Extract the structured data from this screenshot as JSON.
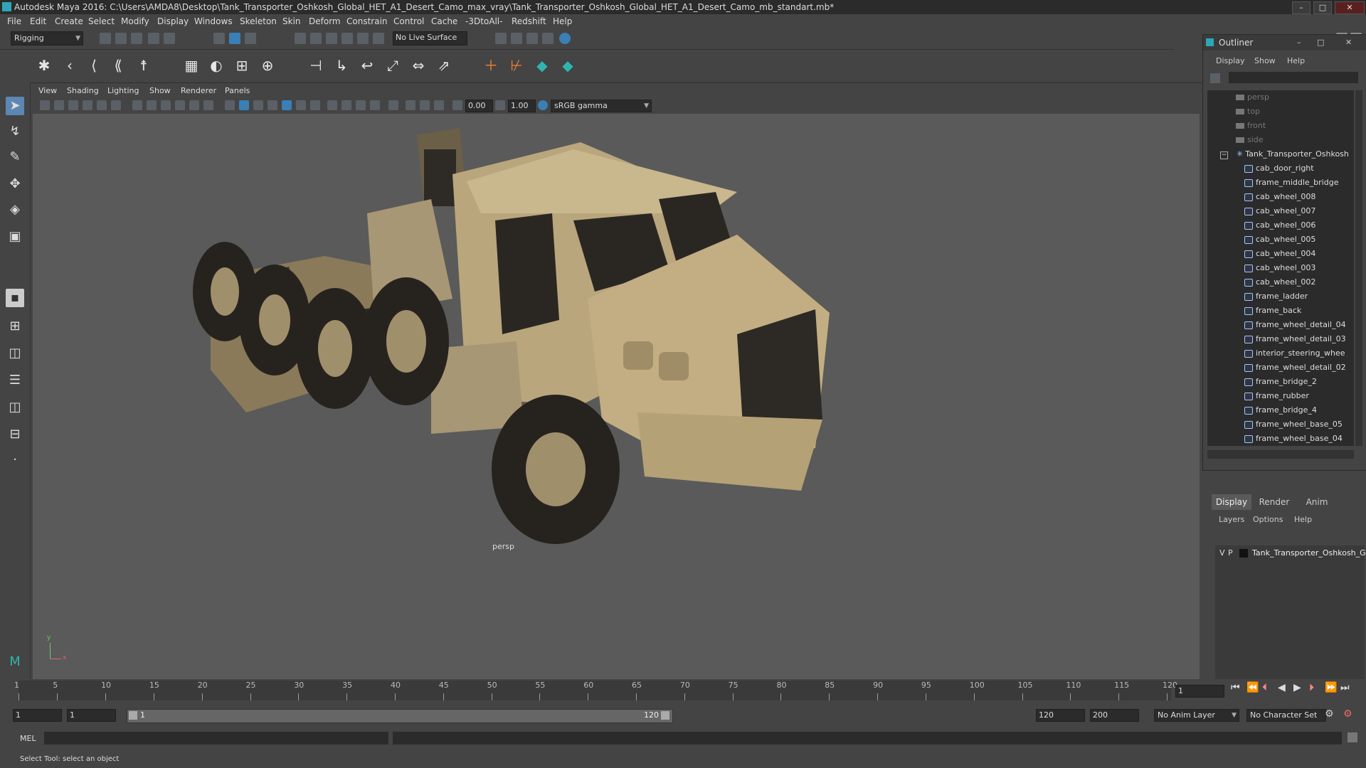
{
  "window": {
    "title": "Autodesk Maya 2016: C:\\Users\\AMDA8\\Desktop\\Tank_Transporter_Oshkosh_Global_HET_A1_Desert_Camo_max_vray\\Tank_Transporter_Oshkosh_Global_HET_A1_Desert_Camo_mb_standart.mb*",
    "min": "–",
    "max": "□",
    "close": "✕"
  },
  "menu": [
    "File",
    "Edit",
    "Create",
    "Select",
    "Modify",
    "Display",
    "Windows",
    "Skeleton",
    "Skin",
    "Deform",
    "Constrain",
    "Control",
    "Cache",
    "-3DtoAll-",
    "Redshift",
    "Help"
  ],
  "statusline": {
    "menuset": "Rigging",
    "live_surface": "No Live Surface"
  },
  "viewport": {
    "menu": [
      "View",
      "Shading",
      "Lighting",
      "Show",
      "Renderer",
      "Panels"
    ],
    "exposure": "0.00",
    "gamma": "1.00",
    "color_space": "sRGB gamma",
    "camera_label": "persp",
    "axis_y": "y",
    "axis_x": "x"
  },
  "outliner": {
    "title": "Outliner",
    "menu": [
      "Display",
      "Show",
      "Help"
    ],
    "cameras": [
      "persp",
      "top",
      "front",
      "side"
    ],
    "group": "Tank_Transporter_Oshkosh",
    "group_toggle": "−",
    "items": [
      "cab_door_right",
      "frame_middle_bridge",
      "cab_wheel_008",
      "cab_wheel_007",
      "cab_wheel_006",
      "cab_wheel_005",
      "cab_wheel_004",
      "cab_wheel_003",
      "cab_wheel_002",
      "frame_ladder",
      "frame_back",
      "frame_wheel_detail_04",
      "frame_wheel_detail_03",
      "interior_steering_whee",
      "frame_wheel_detail_02",
      "frame_bridge_2",
      "frame_rubber",
      "frame_bridge_4",
      "frame_wheel_base_05",
      "frame_wheel_base_04"
    ]
  },
  "layers": {
    "tabs": [
      "Display",
      "Render",
      "Anim"
    ],
    "menu": [
      "Layers",
      "Options",
      "Help"
    ],
    "row": {
      "v": "V",
      "p": "P",
      "name": "Tank_Transporter_Oshkosh_G"
    }
  },
  "timeline": {
    "ticks": [
      1,
      5,
      10,
      15,
      20,
      25,
      30,
      35,
      40,
      45,
      50,
      55,
      60,
      65,
      70,
      75,
      80,
      85,
      90,
      95,
      100,
      105,
      110,
      115,
      120
    ],
    "current_frame": "1"
  },
  "range": {
    "start": "1",
    "inner_start": "1",
    "slider_start": "1",
    "slider_end": "120",
    "inner_end": "120",
    "end": "200",
    "anim_layer": "No Anim Layer",
    "char_set": "No Character Set"
  },
  "cmdline": {
    "label": "MEL"
  },
  "helpline": {
    "text": "Select Tool: select an object"
  },
  "colors": {
    "title_bg": "#2b2b2b",
    "panel_bg": "#444444",
    "viewport_bg": "#5a5a5a",
    "accent": "#5d87b3",
    "truck": "#bfaa80"
  }
}
